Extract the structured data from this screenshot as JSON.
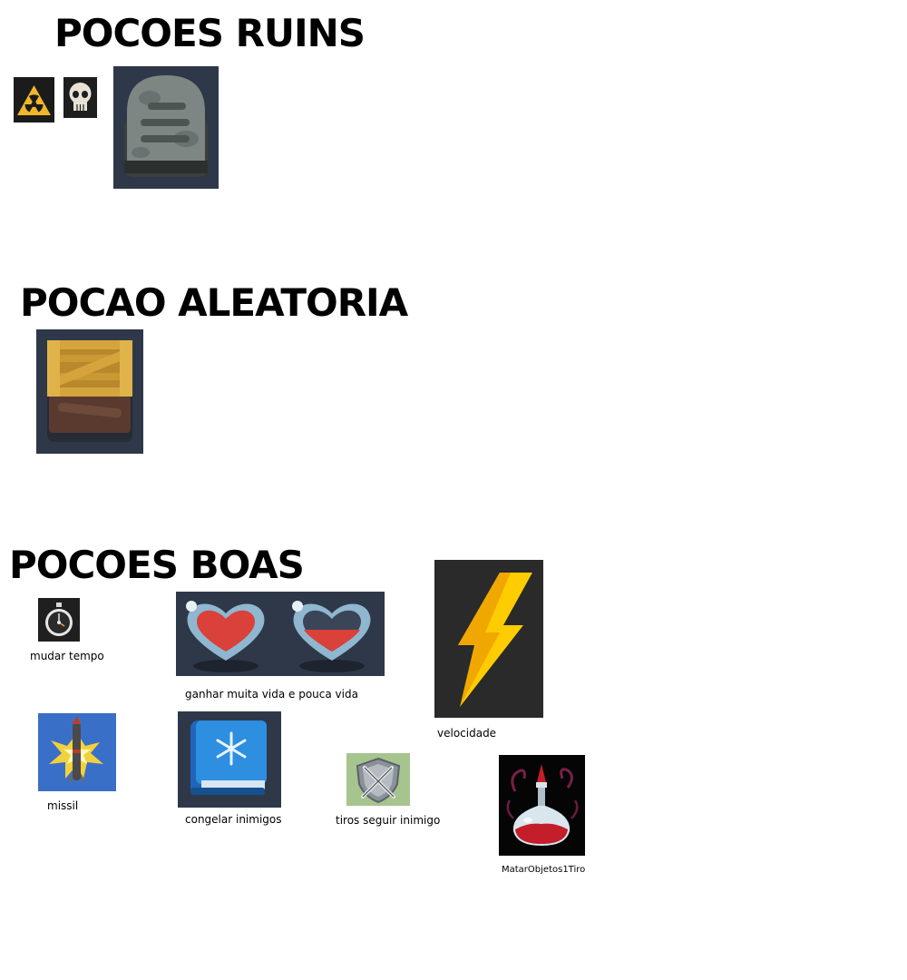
{
  "sections": {
    "bad": {
      "title": "POCOES RUINS",
      "icons": [
        "radiation-icon",
        "skull-icon",
        "tombstone-icon"
      ]
    },
    "random": {
      "title": "POCAO ALEATORIA",
      "icons": [
        "wooden-crate-icon"
      ]
    },
    "good": {
      "title": "POCOES BOAS",
      "items": [
        {
          "icon": "stopwatch-icon",
          "label": "mudar tempo"
        },
        {
          "icon": "hearts-icon",
          "label": "ganhar muita vida e pouca vida"
        },
        {
          "icon": "lightning-bolt-icon",
          "label": "velocidade"
        },
        {
          "icon": "missile-icon",
          "label": "missil"
        },
        {
          "icon": "ice-book-icon",
          "label": "congelar inimigos"
        },
        {
          "icon": "crossed-swords-shield-icon",
          "label": "tiros seguir inimigo"
        },
        {
          "icon": "red-potion-icon",
          "label": "MatarObjetos1Tiro"
        }
      ]
    }
  }
}
